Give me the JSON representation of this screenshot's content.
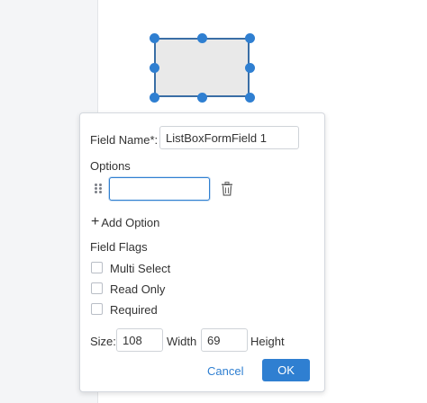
{
  "dialog": {
    "field_name_label": "Field Name*:",
    "field_name_value": "ListBoxFormField 1",
    "options_label": "Options",
    "option_input_value": "",
    "add_option_icon": "+",
    "add_option_label": "Add Option",
    "field_flags_label": "Field Flags",
    "flags": [
      {
        "label": "Multi Select",
        "checked": false
      },
      {
        "label": "Read Only",
        "checked": false
      },
      {
        "label": "Required",
        "checked": false
      }
    ],
    "size_label": "Size:",
    "width_value": "108",
    "width_label": "Width",
    "height_value": "69",
    "height_label": "Height",
    "cancel_label": "Cancel",
    "ok_label": "OK"
  },
  "colors": {
    "accent": "#2f7fd1",
    "handle": "#2f7fd1",
    "shape_fill": "#e9e9e9"
  },
  "icons": {
    "drag": "drag-handle-icon",
    "delete": "trash-icon",
    "add": "plus-icon"
  }
}
